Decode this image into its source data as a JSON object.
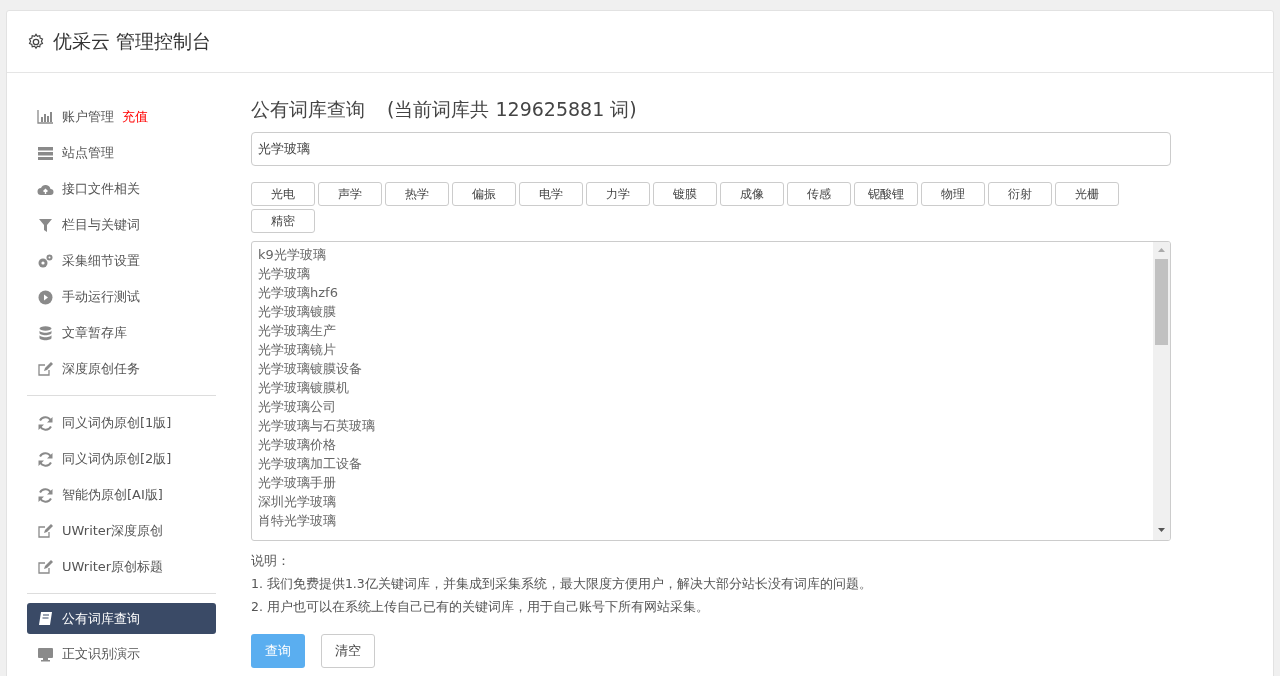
{
  "header": {
    "title": "优采云 管理控制台"
  },
  "sidebar": {
    "groups": [
      [
        {
          "label": "账户管理",
          "badge": "充值",
          "selected": false
        },
        {
          "label": "站点管理",
          "selected": false
        },
        {
          "label": "接口文件相关",
          "selected": false
        },
        {
          "label": "栏目与关键词",
          "selected": false
        },
        {
          "label": "采集细节设置",
          "selected": false
        },
        {
          "label": "手动运行测试",
          "selected": false
        },
        {
          "label": "文章暂存库",
          "selected": false
        },
        {
          "label": "深度原创任务",
          "selected": false
        }
      ],
      [
        {
          "label": "同义词伪原创[1版]",
          "selected": false
        },
        {
          "label": "同义词伪原创[2版]",
          "selected": false
        },
        {
          "label": "智能伪原创[AI版]",
          "selected": false
        },
        {
          "label": "UWriter深度原创",
          "selected": false
        },
        {
          "label": "UWriter原创标题",
          "selected": false
        }
      ],
      [
        {
          "label": "公有词库查询",
          "selected": true
        },
        {
          "label": "正文识别演示",
          "selected": false
        }
      ]
    ]
  },
  "main": {
    "title": "公有词库查询",
    "subtitle": "(当前词库共 129625881 词)",
    "search": {
      "value": "光学玻璃"
    },
    "tags": [
      "光电",
      "声学",
      "热学",
      "偏振",
      "电学",
      "力学",
      "镀膜",
      "成像",
      "传感",
      "铌酸锂",
      "物理",
      "衍射",
      "光栅",
      "精密"
    ],
    "results": [
      "k9光学玻璃",
      "光学玻璃",
      "光学玻璃hzf6",
      "光学玻璃镀膜",
      "光学玻璃生产",
      "光学玻璃镜片",
      "光学玻璃镀膜设备",
      "光学玻璃镀膜机",
      "光学玻璃公司",
      "光学玻璃与石英玻璃",
      "光学玻璃价格",
      "光学玻璃加工设备",
      "光学玻璃手册",
      "深圳光学玻璃",
      "肖特光学玻璃"
    ],
    "notes_title": "说明：",
    "notes": [
      "1. 我们免费提供1.3亿关键词库，并集成到采集系统，最大限度方便用户，解决大部分站长没有词库的问题。",
      "2. 用户也可以在系统上传自己已有的关键词库，用于自己账号下所有网站采集。"
    ],
    "buttons": [
      {
        "label": "查询",
        "kind": "primary"
      },
      {
        "label": "清空",
        "kind": "secondary"
      }
    ]
  }
}
